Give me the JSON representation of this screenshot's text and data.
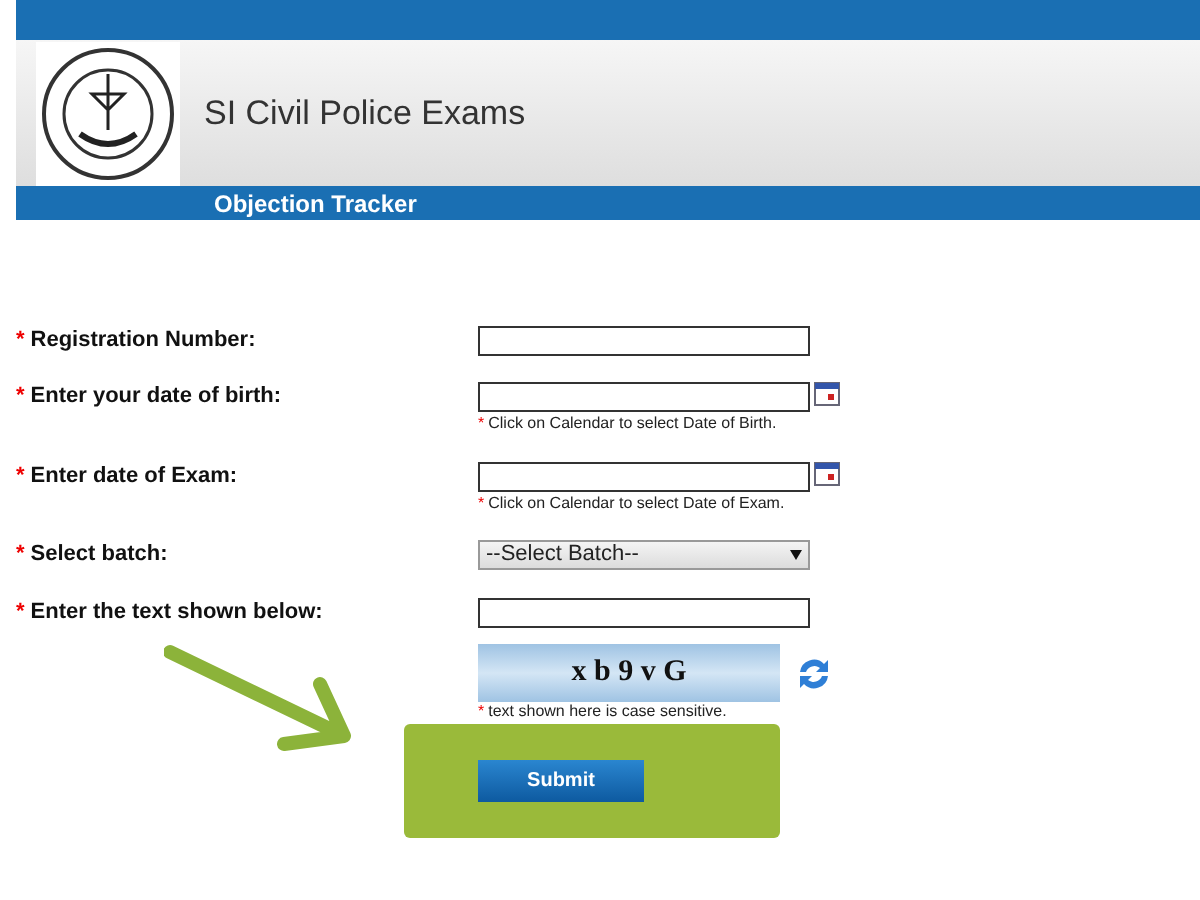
{
  "header": {
    "title": "SI Civil Police Exams"
  },
  "nav_bar": {
    "title": "Objection Tracker"
  },
  "form": {
    "required_mark": "*",
    "fields": [
      {
        "kind": "text",
        "label": "Registration Number:"
      },
      {
        "kind": "date",
        "label": "Enter your date of birth:",
        "hint": "Click on Calendar to select Date of Birth."
      },
      {
        "kind": "date",
        "label": "Enter date of Exam:",
        "hint": "Click on Calendar to select Date of Exam."
      },
      {
        "kind": "select",
        "label": "Select batch:",
        "value": "--Select Batch--"
      },
      {
        "kind": "text",
        "label": "Enter the text shown below:"
      }
    ],
    "captcha": {
      "text": "x b 9 v G",
      "hint": "text shown here is case sensitive."
    },
    "submit": "Submit"
  }
}
